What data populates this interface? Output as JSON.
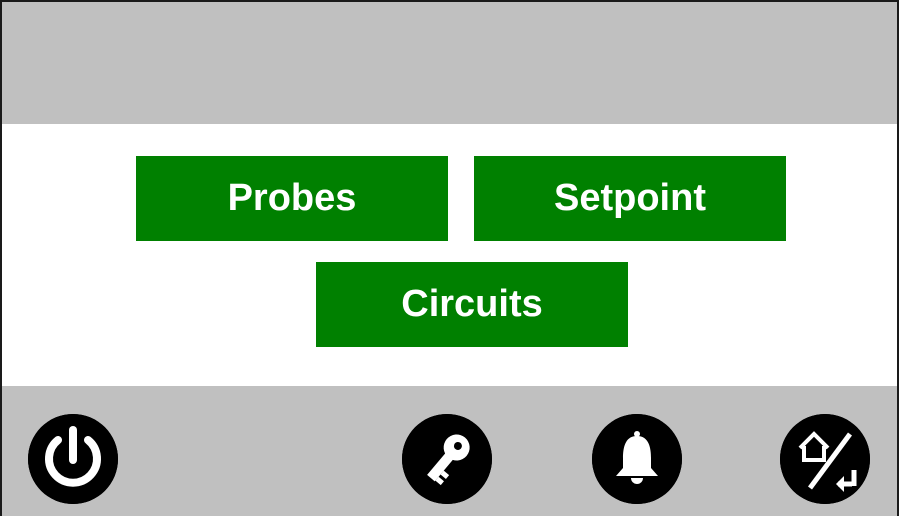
{
  "menu": {
    "probes_label": "Probes",
    "setpoint_label": "Setpoint",
    "circuits_label": "Circuits"
  },
  "footer": {
    "buttons": [
      {
        "icon": "power-icon"
      },
      {
        "icon": "key-icon"
      },
      {
        "icon": "bell-icon"
      },
      {
        "icon": "home-back-icon"
      }
    ]
  },
  "colors": {
    "header_bg": "#c0c0c0",
    "button_green": "#008000",
    "button_text": "#ffffff",
    "icon_bg": "#000000"
  }
}
